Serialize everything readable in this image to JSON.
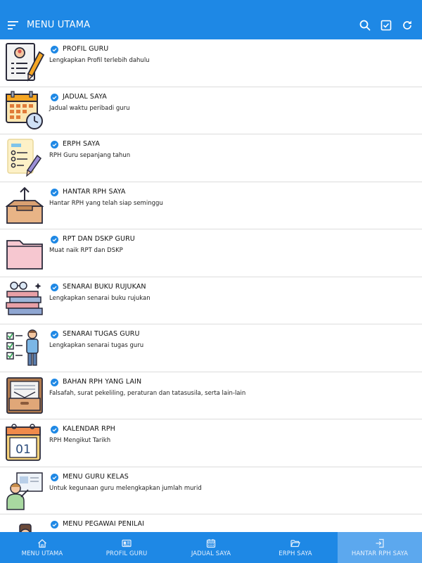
{
  "appbar": {
    "title": "MENU UTAMA",
    "menu_icon": "hamburger-menu-icon",
    "actions": [
      "search-icon",
      "checkbox-icon",
      "refresh-icon"
    ]
  },
  "menu_items": [
    {
      "title": "PROFIL GURU",
      "desc": "Lengkapkan Profil terlebih dahulu",
      "icon": "profile-document-icon"
    },
    {
      "title": "JADUAL SAYA",
      "desc": "Jadual waktu peribadi guru",
      "icon": "calendar-clock-icon"
    },
    {
      "title": "ERPH SAYA",
      "desc": "RPH Guru sepanjang tahun",
      "icon": "checklist-pencil-icon"
    },
    {
      "title": "HANTAR RPH SAYA",
      "desc": "Hantar RPH yang telah siap seminggu",
      "icon": "outbox-tray-icon"
    },
    {
      "title": "RPT DAN DSKP GURU",
      "desc": "Muat naik RPT dan DSKP",
      "icon": "folder-icon"
    },
    {
      "title": "SENARAI BUKU RUJUKAN",
      "desc": "Lengkapkan senarai buku rujukan",
      "icon": "books-glasses-icon"
    },
    {
      "title": "SENARAI TUGAS GURU",
      "desc": "Lengkapkan senarai tugas guru",
      "icon": "task-list-person-icon"
    },
    {
      "title": "BAHAN RPH YANG LAIN",
      "desc": "Falsafah, surat pekeliling, peraturan dan tatasusila, serta lain-lain",
      "icon": "archive-drawer-icon"
    },
    {
      "title": "KALENDAR RPH",
      "desc": "RPH Mengikut Tarikh",
      "icon": "calendar-date-icon",
      "icon_text": "01"
    },
    {
      "title": "MENU GURU KELAS",
      "desc": "Untuk kegunaan guru melengkapkan jumlah murid",
      "icon": "teacher-board-icon"
    },
    {
      "title": "MENU PEGAWAI PENILAI",
      "desc": "",
      "icon": "evaluator-person-icon"
    }
  ],
  "bottom_nav": [
    {
      "label": "MENU UTAMA",
      "icon": "home-icon",
      "active": false
    },
    {
      "label": "PROFIL GURU",
      "icon": "id-card-icon",
      "active": false
    },
    {
      "label": "JADUAL SAYA",
      "icon": "calendar-icon",
      "active": false
    },
    {
      "label": "ERPH SAYA",
      "icon": "open-folder-icon",
      "active": false
    },
    {
      "label": "HANTAR RPH SAYA",
      "icon": "submit-icon",
      "active": true
    }
  ],
  "colors": {
    "primary": "#1e88e5",
    "active_tab": "#5ca8ee",
    "check": "#1e88e5"
  }
}
